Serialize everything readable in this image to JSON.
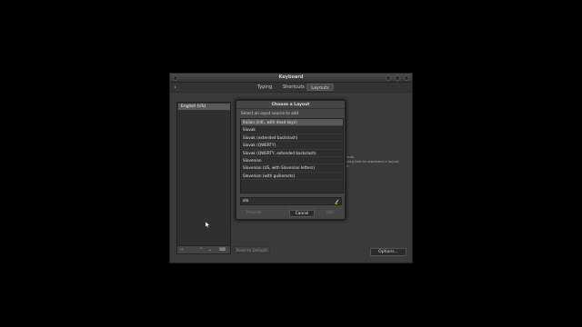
{
  "window": {
    "title": "Keyboard",
    "tabs": [
      "Typing",
      "Shortcuts",
      "Layouts"
    ],
    "active_tab": "Layouts",
    "input_sources": [
      "English (US)"
    ],
    "reset_label": "Reset to Defaults",
    "options_label": "Options...",
    "right_text_lines": [
      "nuts",
      "sing text to represent a layout",
      "e"
    ]
  },
  "dialog": {
    "title": "Choose a Layout",
    "subtitle": "Select an input source to add",
    "items": [
      "Italian (intl., with dead keys)",
      "Slovak",
      "Slovak (extended backslash)",
      "Slovak (QWERTY)",
      "Slovak (QWERTY, extended backslash)",
      "Slovenian",
      "Slovenian (US, with Slovenian letters)",
      "Slovenian (with guillemets)"
    ],
    "selected_index": 0,
    "search_value": "slo",
    "preview_label": "Preview",
    "cancel_label": "Cancel",
    "add_label": "Add"
  },
  "colors": {
    "background": "#000000",
    "window": "#3a3a3a",
    "dialog": "#454545"
  }
}
